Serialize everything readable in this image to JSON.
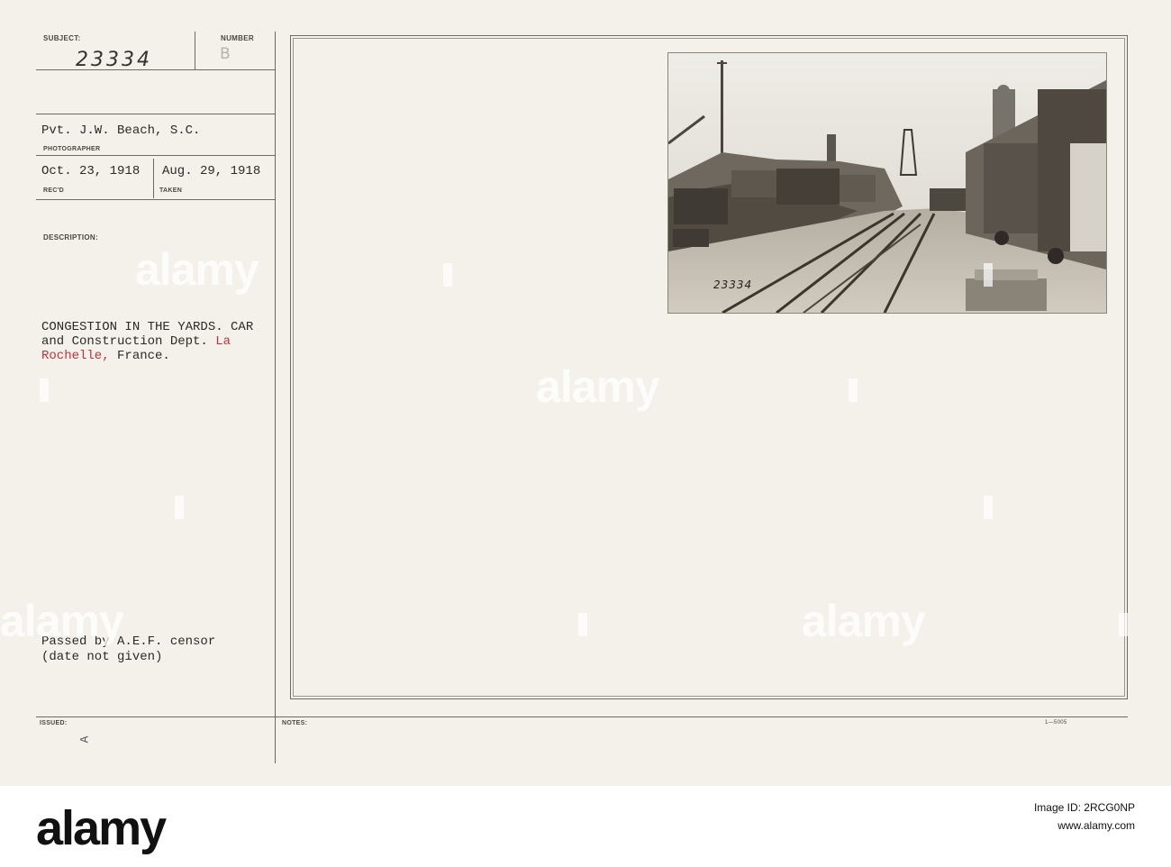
{
  "record": {
    "subject_label": "SUBJECT:",
    "number_label": "NUMBER",
    "subject_value": "23334",
    "number_value": "B",
    "photographer": "Pvt. J.W. Beach, S.C.",
    "photographer_label": "PHOTOGRAPHER",
    "received_date": "Oct. 23, 1918",
    "received_label": "REC'D",
    "taken_date": "Aug. 29, 1918",
    "taken_label": "TAKEN",
    "description_label": "DESCRIPTION:",
    "description_lines": [
      "CONGESTION IN THE YARDS. CAR",
      "and Construction Dept. ",
      "Rochelle, France."
    ],
    "description_red_1": "La",
    "description_red_2": "Rochelle,",
    "description_line3_rest": " France.",
    "censor_line1": "Passed by A.E.F. censor",
    "censor_line2": "(date not given)",
    "issued_label": "ISSUED:",
    "issued_mark": "A",
    "notes_label": "NOTES:",
    "form_number": "1—5005"
  },
  "photo": {
    "caption_number": "23334"
  },
  "watermark": {
    "text": "alamy"
  },
  "footer": {
    "logo": "alamy",
    "image_id_line": "Image ID: 2RCG0NP",
    "site_line": "www.alamy.com"
  }
}
